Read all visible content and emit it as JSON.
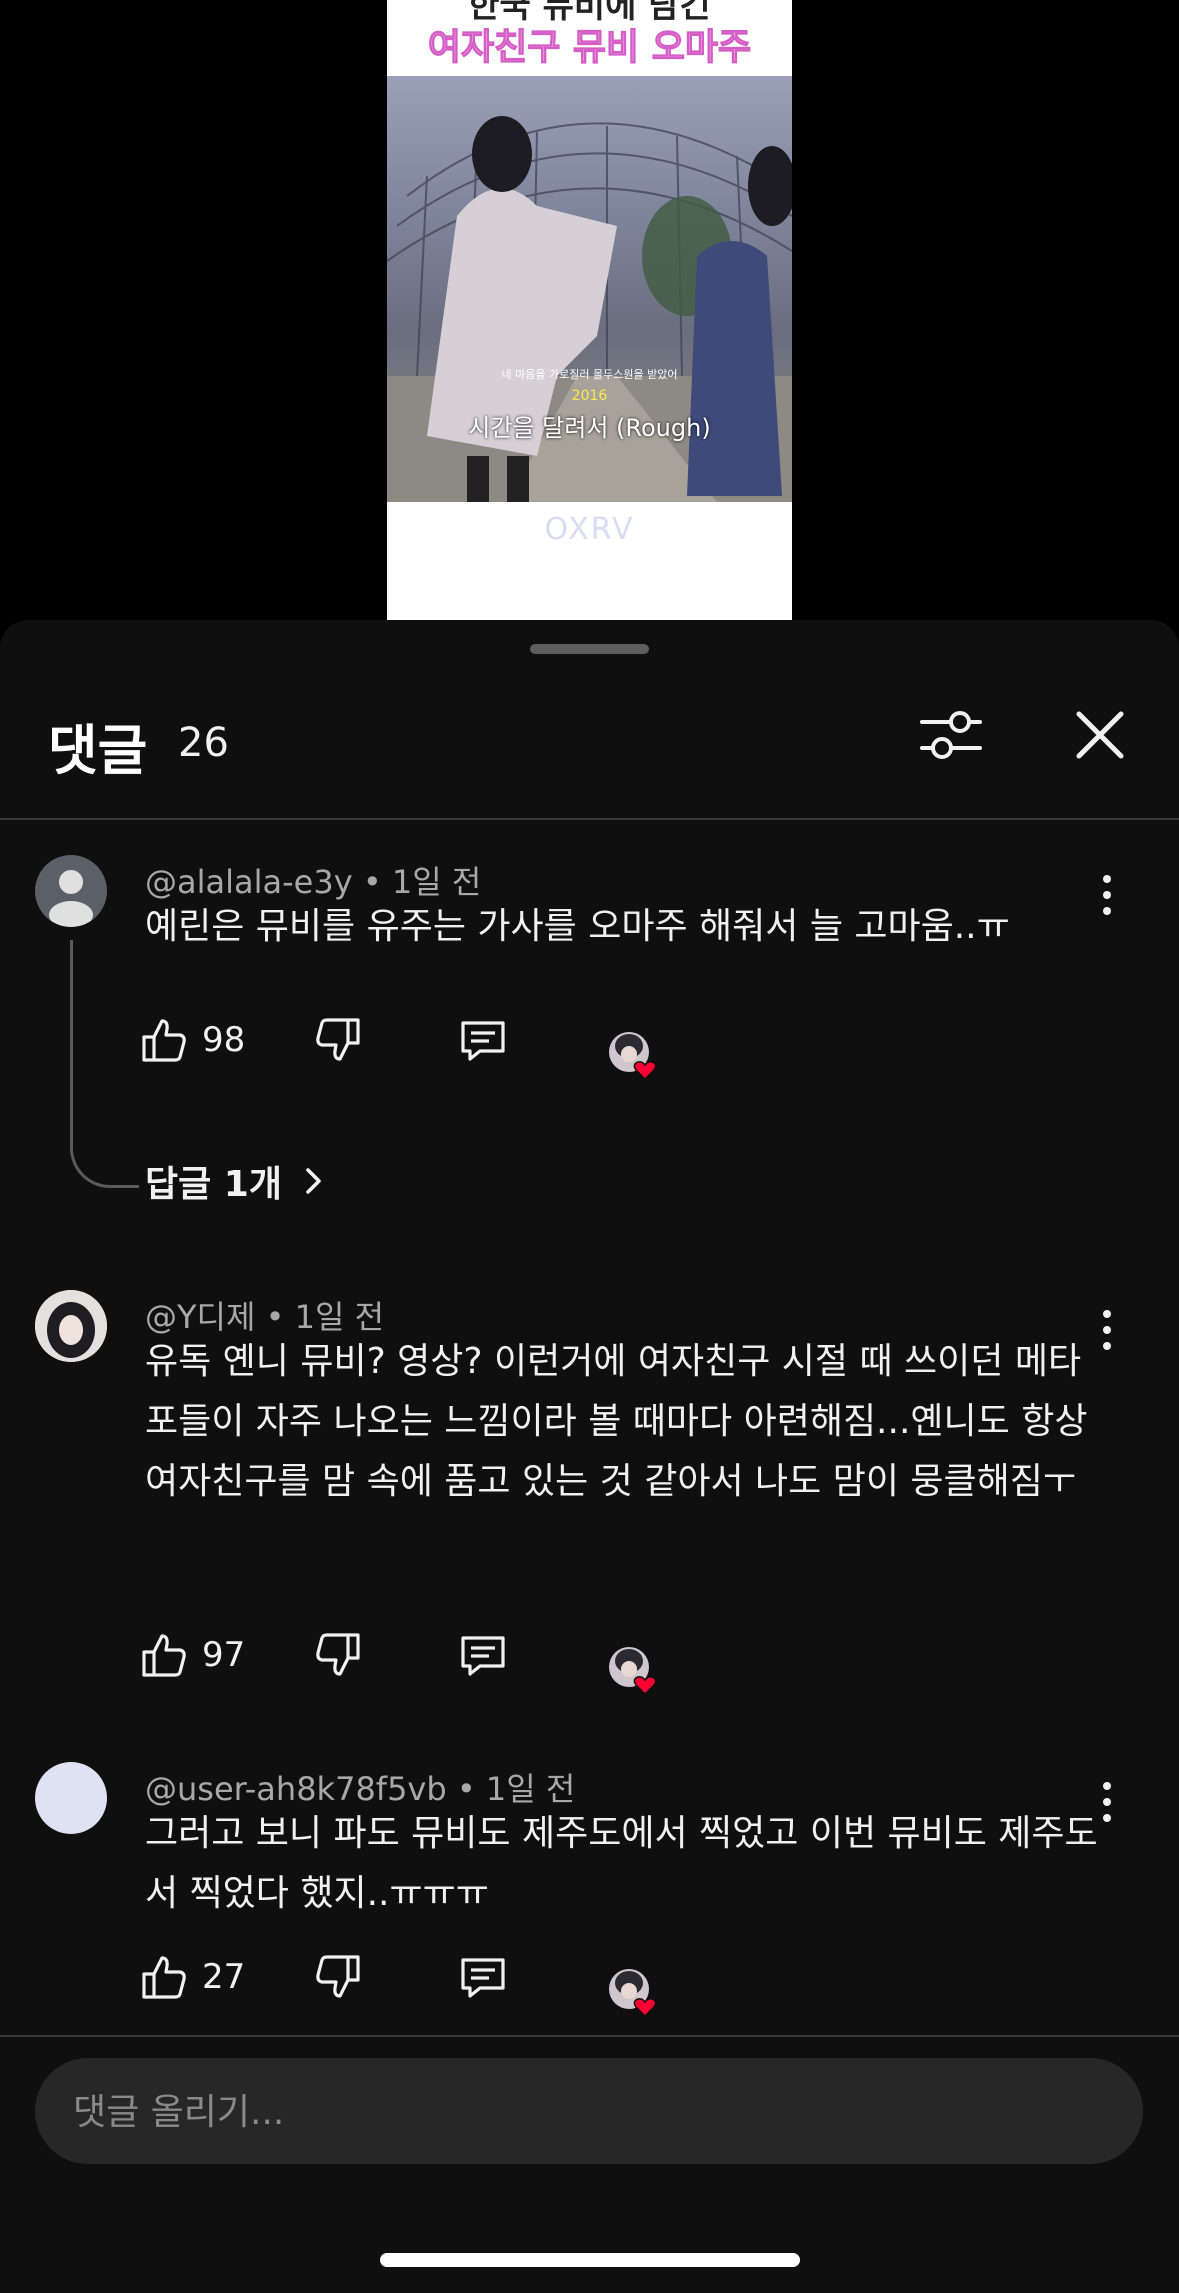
{
  "video": {
    "caption_top": "한국 뮤비에 담긴",
    "caption_title": "여자친구 뮤비 오마주",
    "subtitle_small": "네 마음을 가로질러 몰두스원을 받았어",
    "year": "2016",
    "subtitle_main": "시간을 달려서 (Rough)",
    "logo": "OXRV"
  },
  "sheet": {
    "title": "댓글",
    "count": "26",
    "filter_icon": "filter-sliders-icon",
    "close_icon": "close-icon"
  },
  "comments": [
    {
      "author": "@alalala-e3y",
      "time": "• 1일 전",
      "text": "예린은 뮤비를 유주는 가사를 오마주 해줘서 늘 고마움..ㅠ",
      "likes": "98",
      "replies": "답글 1개"
    },
    {
      "author": "@Y디제",
      "time": "• 1일 전",
      "text": "유독 옌니 뮤비? 영상? 이런거에 여자친구 시절 때 쓰이던 메타포들이 자주 나오는 느낌이라 볼 때마다 아련해짐...옌니도 항상 여자친구를 맘 속에 품고 있는 것 같아서 나도 맘이 뭉클해짐ㅜ",
      "likes": "97"
    },
    {
      "author": "@user-ah8k78f5vb",
      "time": "• 1일 전",
      "text": "그러고 보니 파도 뮤비도 제주도에서 찍었고 이번 뮤비도 제주도서 찍었다 했지..ㅠㅠㅠ",
      "likes": "27"
    }
  ],
  "input": {
    "placeholder": "댓글 올리기..."
  },
  "colors": {
    "sheet_bg": "#0f0f0f",
    "heart": "#ff0033",
    "accent_pink": "#f5a8e8"
  }
}
